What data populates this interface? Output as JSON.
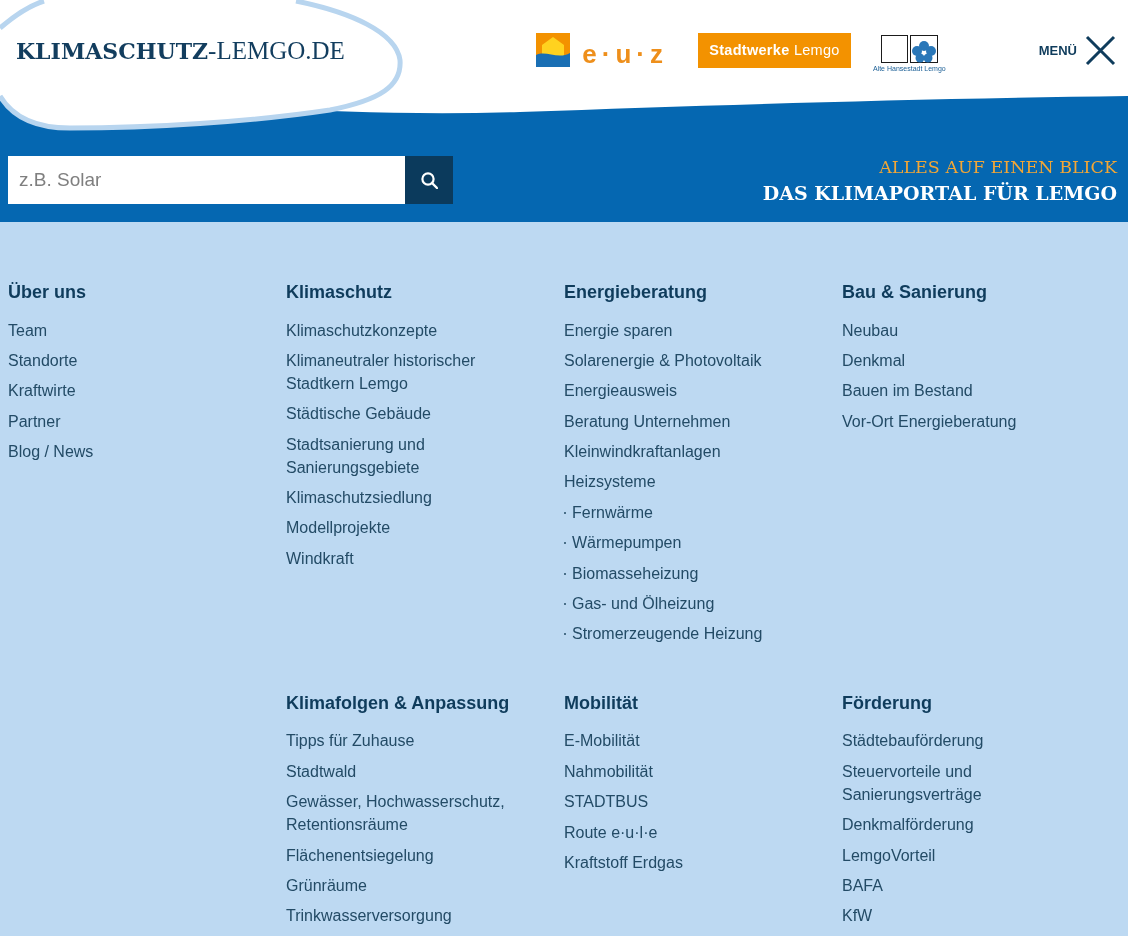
{
  "header": {
    "logo": "**KLIMASCHUTZ**-LEMGO.DE",
    "partners": [
      {
        "kind": "euz",
        "label": "e·u·z"
      },
      {
        "kind": "stadtwerke",
        "label": "**Stadtwerke** Lemgo"
      },
      {
        "kind": "hansestadt",
        "label": "Alte Hansestadt Lemgo"
      }
    ],
    "menu_button": {
      "label": "MENÜ",
      "expanded": true
    }
  },
  "search": {
    "placeholder": "z.B. Solar"
  },
  "tagline": {
    "kicker": "ALLES AUF EINEN BLICK",
    "title": "DAS KLIMAPORTAL FÜR LEMGO"
  },
  "sections": [
    {
      "title": "Über uns",
      "items": [
        {
          "label": "Team"
        },
        {
          "label": "Standorte"
        },
        {
          "label": "Kraftwirte"
        },
        {
          "label": "Partner"
        },
        {
          "label": "Blog / News"
        }
      ]
    },
    {
      "title": "Klimaschutz",
      "items": [
        {
          "label": "Klimaschutzkonzepte"
        },
        {
          "label": "Klimaneutraler historischer Stadtkern Lemgo"
        },
        {
          "label": "Städtische Gebäude"
        },
        {
          "label": "Stadtsanierung und Sanierungsgebiete"
        },
        {
          "label": "Klimaschutzsiedlung"
        },
        {
          "label": "Modellprojekte"
        },
        {
          "label": "Windkraft"
        }
      ]
    },
    {
      "title": "Energieberatung",
      "items": [
        {
          "label": "Energie sparen"
        },
        {
          "label": "Solarenergie & Photovoltaik"
        },
        {
          "label": "Energieausweis"
        },
        {
          "label": "Beratung Unternehmen"
        },
        {
          "label": "Kleinwindkraftanlagen"
        },
        {
          "label": "Heizsysteme",
          "children": [
            {
              "label": "Fernwärme"
            },
            {
              "label": "Wärmepumpen"
            },
            {
              "label": "Biomasseheizung"
            },
            {
              "label": "Gas- und Ölheizung"
            },
            {
              "label": "Stromerzeugende Heizung"
            }
          ]
        }
      ]
    },
    {
      "title": "Bau & Sanierung",
      "items": [
        {
          "label": "Neubau"
        },
        {
          "label": "Denkmal"
        },
        {
          "label": "Bauen im Bestand"
        },
        {
          "label": "Vor-Ort Energieberatung"
        }
      ]
    },
    {
      "title": "Klimafolgen & Anpassung",
      "items": [
        {
          "label": "Tipps für Zuhause"
        },
        {
          "label": "Stadtwald"
        },
        {
          "label": "Gewässer, Hochwasserschutz, Retentionsräume"
        },
        {
          "label": "Flächenentsiegelung"
        },
        {
          "label": "Grünräume"
        },
        {
          "label": "Trinkwasserversorgung"
        }
      ]
    },
    {
      "title": "Mobilität",
      "items": [
        {
          "label": "E-Mobilität"
        },
        {
          "label": "Nahmobilität"
        },
        {
          "label": "STADTBUS"
        },
        {
          "label": "Route e·u·l·e"
        },
        {
          "label": "Kraftstoff Erdgas"
        }
      ]
    },
    {
      "title": "Förderung",
      "items": [
        {
          "label": "Städtebauförderung"
        },
        {
          "label": "Steuervorteile und Sanierungsverträge"
        },
        {
          "label": "Denkmalförderung"
        },
        {
          "label": "LemgoVorteil"
        },
        {
          "label": "BAFA"
        },
        {
          "label": "KfW"
        }
      ]
    }
  ]
}
